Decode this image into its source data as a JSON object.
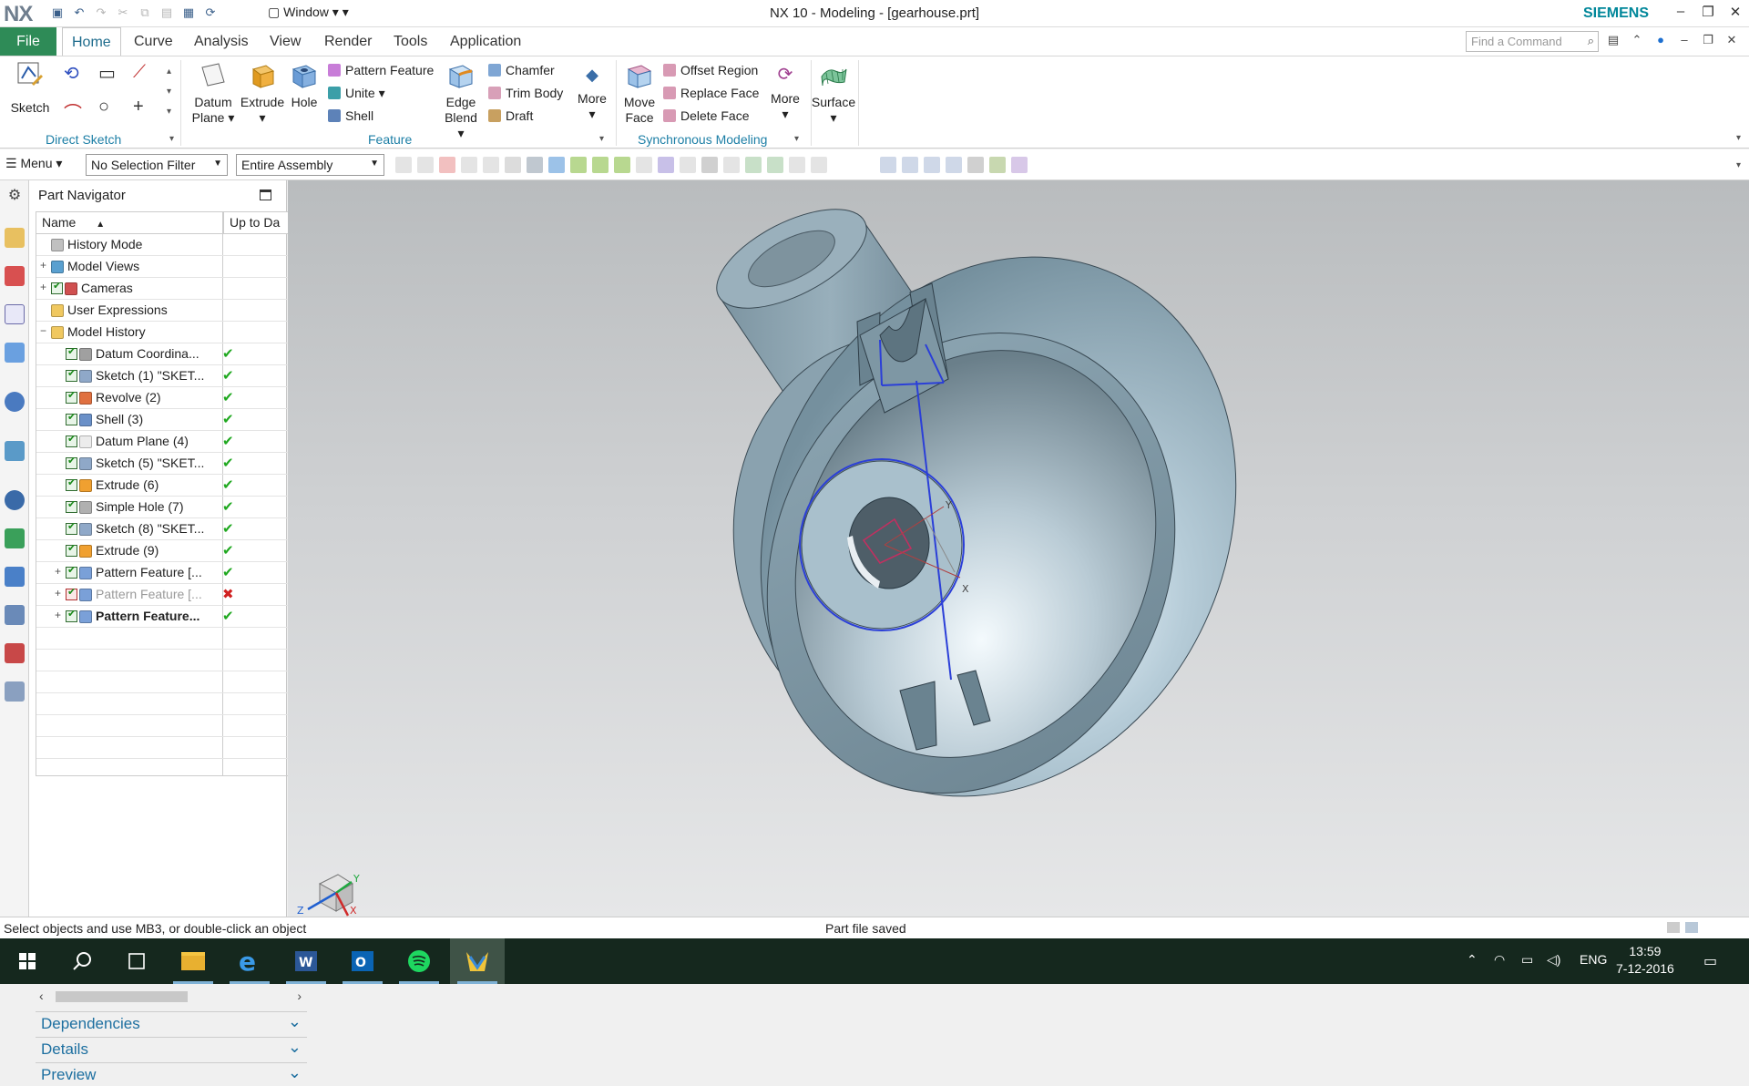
{
  "window": {
    "logo": "NX",
    "title": "NX 10 - Modeling - [gearhouse.prt]",
    "brand": "SIEMENS",
    "window_menu": "Window ▾ ▾"
  },
  "menu_tabs": {
    "file": "File",
    "tabs": [
      "Home",
      "Curve",
      "Analysis",
      "View",
      "Render",
      "Tools",
      "Application"
    ],
    "active": "Home",
    "search_placeholder": "Find a Command"
  },
  "ribbon": {
    "sketch": "Sketch",
    "groups": {
      "direct_sketch": "Direct Sketch",
      "feature": "Feature",
      "synchronous": "Synchronous Modeling"
    },
    "datum_plane": [
      "Datum",
      "Plane ▾"
    ],
    "extrude": [
      "Extrude",
      "▾"
    ],
    "hole": "Hole",
    "pattern_feature": "Pattern Feature",
    "unite": "Unite ▾",
    "shell": "Shell",
    "edge_blend": [
      "Edge",
      "Blend ▾"
    ],
    "chamfer": "Chamfer",
    "trim_body": "Trim Body",
    "draft": "Draft",
    "more_feature": [
      "More",
      "▾"
    ],
    "move_face": [
      "Move",
      "Face"
    ],
    "offset_region": "Offset Region",
    "replace_face": "Replace Face",
    "delete_face": "Delete Face",
    "more_sync": [
      "More",
      "▾"
    ],
    "surface": [
      "Surface",
      "▾"
    ]
  },
  "selection_bar": {
    "menu": "Menu ▾",
    "filter": "No Selection Filter",
    "scope": "Entire Assembly"
  },
  "part_navigator": {
    "title": "Part Navigator",
    "columns": [
      "Name",
      "Up to Da"
    ],
    "rows": [
      {
        "label": "History Mode",
        "level": 0,
        "expander": "",
        "checkbox": false,
        "status": "",
        "icon": "clock-icon"
      },
      {
        "label": "Model Views",
        "level": 0,
        "expander": "+",
        "checkbox": false,
        "status": "",
        "icon": "views-icon"
      },
      {
        "label": "Cameras",
        "level": 0,
        "expander": "+",
        "checkbox": true,
        "status": "",
        "icon": "camera-icon"
      },
      {
        "label": "User Expressions",
        "level": 0,
        "expander": "",
        "checkbox": false,
        "status": "",
        "icon": "folder-icon"
      },
      {
        "label": "Model History",
        "level": 0,
        "expander": "−",
        "checkbox": false,
        "status": "",
        "icon": "folder-open-icon"
      },
      {
        "label": "Datum Coordina...",
        "level": 1,
        "expander": "",
        "checkbox": true,
        "status": "ok",
        "icon": "datum-csys-icon"
      },
      {
        "label": "Sketch (1) \"SKET...",
        "level": 1,
        "expander": "",
        "checkbox": true,
        "status": "ok",
        "icon": "sketch-icon"
      },
      {
        "label": "Revolve (2)",
        "level": 1,
        "expander": "",
        "checkbox": true,
        "status": "ok",
        "icon": "revolve-icon"
      },
      {
        "label": "Shell (3)",
        "level": 1,
        "expander": "",
        "checkbox": true,
        "status": "ok",
        "icon": "shell-icon"
      },
      {
        "label": "Datum Plane (4)",
        "level": 1,
        "expander": "",
        "checkbox": true,
        "status": "ok",
        "icon": "datum-plane-icon"
      },
      {
        "label": "Sketch (5) \"SKET...",
        "level": 1,
        "expander": "",
        "checkbox": true,
        "status": "ok",
        "icon": "sketch-icon"
      },
      {
        "label": "Extrude (6)",
        "level": 1,
        "expander": "",
        "checkbox": true,
        "status": "ok",
        "icon": "extrude-icon"
      },
      {
        "label": "Simple Hole (7)",
        "level": 1,
        "expander": "",
        "checkbox": true,
        "status": "ok",
        "icon": "hole-icon"
      },
      {
        "label": "Sketch (8) \"SKET...",
        "level": 1,
        "expander": "",
        "checkbox": true,
        "status": "ok",
        "icon": "sketch-icon"
      },
      {
        "label": "Extrude (9)",
        "level": 1,
        "expander": "",
        "checkbox": true,
        "status": "ok",
        "icon": "extrude-icon"
      },
      {
        "label": "Pattern Feature [...",
        "level": 1,
        "expander": "+",
        "checkbox": true,
        "status": "ok",
        "icon": "pattern-icon"
      },
      {
        "label": "Pattern Feature [...",
        "level": 1,
        "expander": "+",
        "checkbox": true,
        "status": "bad",
        "icon": "pattern-icon",
        "disabled": true
      },
      {
        "label": "Pattern Feature...",
        "level": 1,
        "expander": "+",
        "checkbox": true,
        "status": "ok",
        "icon": "pattern-icon",
        "bold": true
      }
    ],
    "panels": [
      "Dependencies",
      "Details",
      "Preview"
    ]
  },
  "triad_labels": {
    "z": "Z",
    "y": "Y",
    "x": "X"
  },
  "wcs_labels": {
    "x": "X",
    "y": "Y"
  },
  "status_bar": {
    "prompt": "Select objects and use MB3, or double-click an object",
    "message": "Part file saved"
  },
  "taskbar": {
    "language": "ENG",
    "time": "13:59",
    "date": "7-12-2016"
  },
  "colors": {
    "file_tab": "#2e8b57",
    "accent": "#1d7fa6",
    "ok": "#1fa81f",
    "error": "#d02020",
    "model_face": "#9cb6c4",
    "sketch_curve": "#2b3fd8"
  }
}
